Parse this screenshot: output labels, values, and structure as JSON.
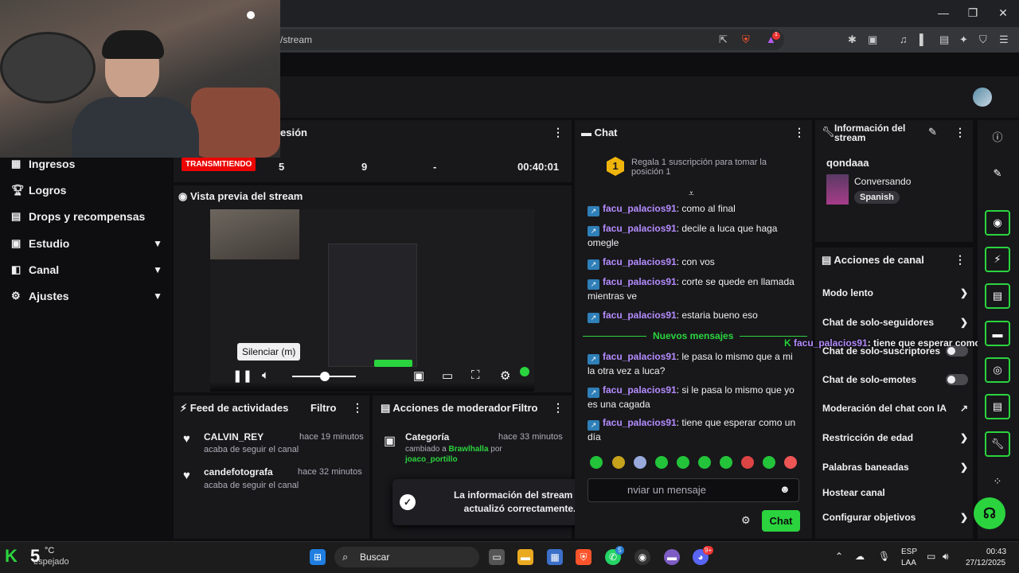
{
  "browser": {
    "url_fragment": "/stream",
    "tab_badge": "1"
  },
  "nav": {
    "items": [
      {
        "label": "Ingresos",
        "icon": "money-icon",
        "chev": false
      },
      {
        "label": "Logros",
        "icon": "trophy-icon",
        "chev": false
      },
      {
        "label": "Drops y recompensas",
        "icon": "drops-icon",
        "chev": false
      },
      {
        "label": "Estudio",
        "icon": "studio-icon",
        "chev": true
      },
      {
        "label": "Canal",
        "icon": "channel-icon",
        "chev": true
      },
      {
        "label": "Ajustes",
        "icon": "gear-icon",
        "chev": true
      }
    ]
  },
  "session": {
    "title_fragment": "esión",
    "status": "TRANSMITIENDO",
    "stat1": "5",
    "stat2": "9",
    "stat3": "-",
    "time": "00:40:01"
  },
  "preview": {
    "title": "Vista previa del stream",
    "tooltip": "Silenciar (m)"
  },
  "feed": {
    "title": "Feed de actividades",
    "filter": "Filtro",
    "items": [
      {
        "user": "CALVIN_REY",
        "time": "hace 19 minutos",
        "desc": "acaba de seguir el canal"
      },
      {
        "user": "candefotografa",
        "time": "hace 32 minutos",
        "desc": "acaba de seguir el canal"
      }
    ]
  },
  "mod": {
    "title": "Acciones de moderador",
    "filter": "Filtro",
    "item": {
      "title": "Categoría",
      "time": "hace 33 minutos",
      "desc_prefix": "cambiado a ",
      "game": "Brawlhalla",
      "by": " por",
      "user": "joaco_portillo"
    }
  },
  "toast": {
    "text": "La información del stream se actualizó correctamente."
  },
  "chat": {
    "title": "Chat",
    "gift_rank": "1",
    "gift_text": "Regala 1 suscripción para tomar la posición 1",
    "messages_old": [
      {
        "user": "facu_palacios91",
        "text": ": como al final"
      },
      {
        "user": "facu_palacios91",
        "text": ": decile a luca que haga omegle"
      },
      {
        "user": "facu_palacios91",
        "text": ": con vos"
      },
      {
        "user": "facu_palacios91",
        "text": ": corte se quede en llamada mientras ve"
      },
      {
        "user": "facu_palacios91",
        "text": ": estaria bueno eso"
      }
    ],
    "new_label": "Nuevos mensajes",
    "messages_new": [
      {
        "user": "facu_palacios91",
        "text": ": le pasa lo mismo que a mi la otra vez a luca?"
      },
      {
        "user": "facu_palacios91",
        "text": ": si le pasa lo mismo que yo es una cagada"
      },
      {
        "user": "facu_palacios91",
        "text": ": tiene que esperar como un día"
      }
    ],
    "input_placeholder": "nviar un mensaje",
    "send": "Chat"
  },
  "overlay": {
    "user": "facu_palacios91",
    "text": ": tiene que esperar como un día"
  },
  "info": {
    "title": "Información del stream",
    "channel": "qondaaa",
    "category": "Conversando",
    "language": "Spanish"
  },
  "actions": {
    "title": "Acciones de canal",
    "items": [
      {
        "label": "Modo lento",
        "kind": "chev"
      },
      {
        "label": "Chat de solo-seguidores",
        "kind": "chev"
      },
      {
        "label": "Chat de solo-suscriptores",
        "kind": "toggle"
      },
      {
        "label": "Chat de solo-emotes",
        "kind": "toggle"
      },
      {
        "label": "Moderación del chat con IA",
        "kind": "ext"
      },
      {
        "label": "Restricción de edad",
        "kind": "chev"
      },
      {
        "label": "Palabras baneadas",
        "kind": "chev"
      },
      {
        "label": "Hostear canal",
        "kind": "none"
      },
      {
        "label": "Configurar objetivos",
        "kind": "chev"
      }
    ]
  },
  "taskbar": {
    "weather_temp": "°C",
    "weather_desc": "espejado",
    "search": "Buscar",
    "lang1": "ESP",
    "lang2": "LAA",
    "time": "00:43",
    "date": "27/12/2025",
    "kick_count": "5",
    "whatsapp_badge": "5",
    "discord_badge": "9+"
  }
}
